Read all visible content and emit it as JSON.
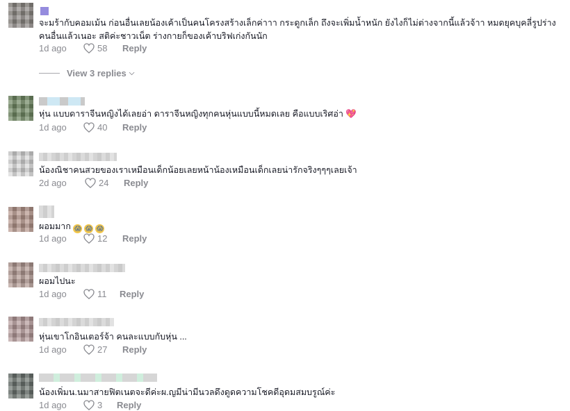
{
  "comments": [
    {
      "text": "จะมร้ากับคอมเม้น ก่อนอื่นเลยน้องเค้าเป็นคนโครงสร้างเล็กค่าาา กระดูกเล็ก ถึงจะเพิ่มน้ำหนัก ยังไงก็ไม่ต่างจากนี้แล้วจ้าา หมดยุคบุคลี่รูปร่างคนอื่นแล้วเนอะ สติค่ะชาวเน็ต ร่างกายก็ของเค้าบริฟเก่งกันนัก",
      "date": "1d ago",
      "likes": "58",
      "reply": "Reply",
      "view_replies": "View 3 replies"
    },
    {
      "text": "หุ่น แบบดาราจีนหญิงได้เลยอ่า ดาราจีนหญิงทุกคนหุ่นแบบนี้หมดเลย คือแบบเริศอ่า",
      "emoji": "💖",
      "date": "1d ago",
      "likes": "40",
      "reply": "Reply"
    },
    {
      "text": "น้องณิชาคนสวยของเราเหมือนเด็กน้อยเลยหน้าน้องเหมือนเด็กเลยน่ารักจริงๆๆๆเลยเจ้า",
      "date": "2d ago",
      "likes": "24",
      "reply": "Reply"
    },
    {
      "text": "ผอมมาก",
      "date": "1d ago",
      "likes": "12",
      "reply": "Reply"
    },
    {
      "text": "ผอมไปนะ",
      "date": "1d ago",
      "likes": "11",
      "reply": "Reply"
    },
    {
      "text": "หุ่นเขาโกอินเตอร์จ้า คนละแบบกับหุ่น ...",
      "date": "1d ago",
      "likes": "27",
      "reply": "Reply"
    },
    {
      "text": "น้องเพิ่มน.นมาสายฟิตเนตจะดีค่ะผ.ญมีน่ามีนวลดึงดูดความโชคดีอุดมสมบรูณ์ค่ะ",
      "date": "1d ago",
      "likes": "3",
      "reply": "Reply"
    }
  ]
}
